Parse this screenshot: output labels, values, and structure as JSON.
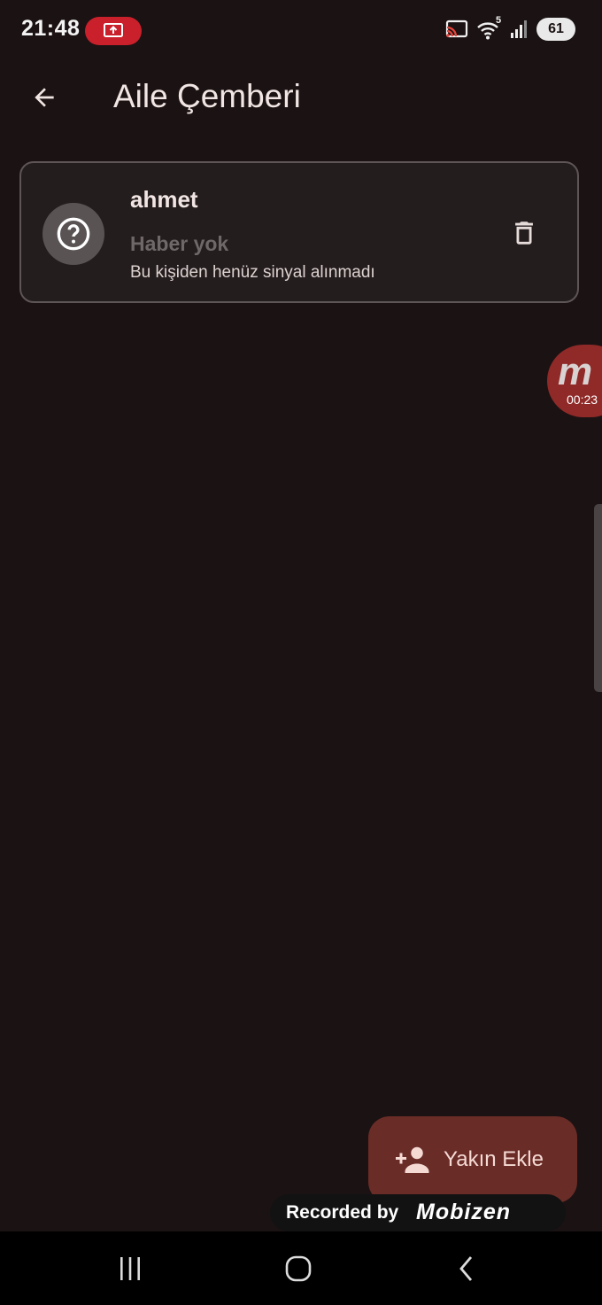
{
  "status_bar": {
    "time": "21:48",
    "battery": "61",
    "icons": [
      "screen-record-icon",
      "cast-icon",
      "wifi-icon",
      "signal-icon",
      "battery-icon"
    ],
    "wifi_badge": "5"
  },
  "appbar": {
    "title": "Aile Çemberi",
    "back_icon": "arrow-back-icon"
  },
  "contacts": [
    {
      "name": "ahmet",
      "status": "Haber yok",
      "detail": "Bu kişiden henüz sinyal alınmadı",
      "avatar_icon": "help-circle-icon",
      "action_icon": "trash-icon"
    }
  ],
  "recorder_overlay": {
    "logo": "m",
    "timer": "00:23",
    "banner_text": "Recorded by",
    "banner_logo": "Mobizen"
  },
  "fab": {
    "label": "Yakın Ekle",
    "icon": "person-add-icon"
  },
  "nav": {
    "icons": [
      "recents-icon",
      "home-icon",
      "back-icon"
    ]
  },
  "colors": {
    "background": "#1b1213",
    "card": "#241d1e",
    "fab": "#6a2c27",
    "record_pill": "#c9202b",
    "muted_status": "#6f6869"
  }
}
